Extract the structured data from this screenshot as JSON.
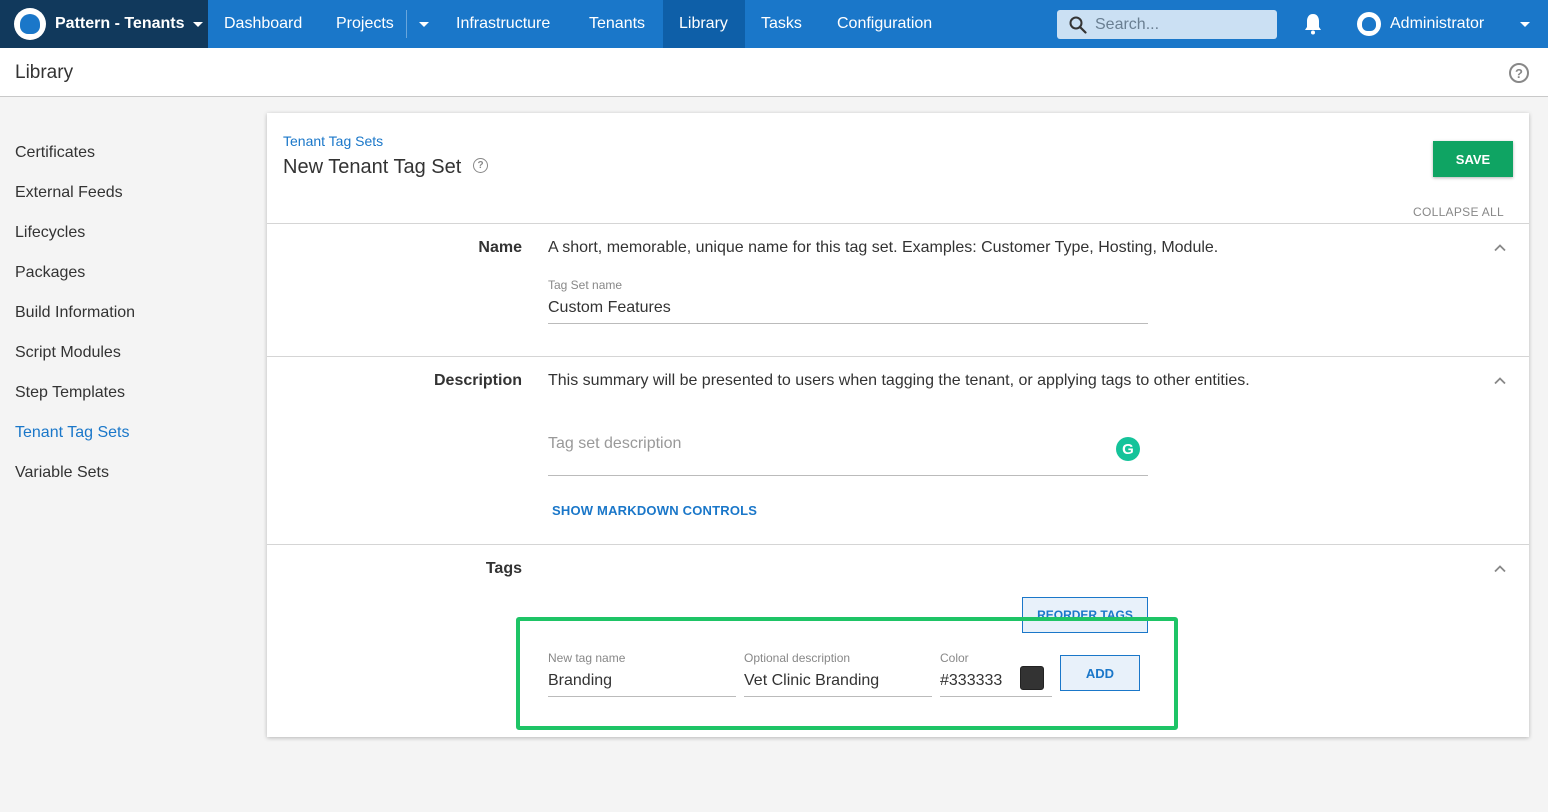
{
  "topnav": {
    "space_name": "Pattern - Tenants",
    "items": [
      {
        "label": "Dashboard"
      },
      {
        "label": "Projects"
      },
      {
        "label": "Infrastructure"
      },
      {
        "label": "Tenants"
      },
      {
        "label": "Library"
      },
      {
        "label": "Tasks"
      },
      {
        "label": "Configuration"
      }
    ],
    "active_item": "Library",
    "search_placeholder": "Search...",
    "user_name": "Administrator"
  },
  "subheader": {
    "title": "Library"
  },
  "sidebar": {
    "items": [
      {
        "label": "Certificates"
      },
      {
        "label": "External Feeds"
      },
      {
        "label": "Lifecycles"
      },
      {
        "label": "Packages"
      },
      {
        "label": "Build Information"
      },
      {
        "label": "Script Modules"
      },
      {
        "label": "Step Templates"
      },
      {
        "label": "Tenant Tag Sets"
      },
      {
        "label": "Variable Sets"
      }
    ],
    "active_item": "Tenant Tag Sets"
  },
  "page": {
    "breadcrumb": "Tenant Tag Sets",
    "title": "New Tenant Tag Set",
    "save_label": "SAVE",
    "collapse_all_label": "COLLAPSE ALL"
  },
  "sections": {
    "name": {
      "label": "Name",
      "description": "A short, memorable, unique name for this tag set. Examples: Customer Type, Hosting, Module.",
      "field_label": "Tag Set name",
      "field_value": "Custom Features"
    },
    "description": {
      "label": "Description",
      "description": "This summary will be presented to users when tagging the tenant, or applying tags to other entities.",
      "field_placeholder": "Tag set description",
      "markdown_link": "SHOW MARKDOWN CONTROLS"
    },
    "tags": {
      "label": "Tags",
      "reorder_label": "REORDER TAGS",
      "new_tag_label": "New tag name",
      "new_tag_value": "Branding",
      "desc_label": "Optional description",
      "desc_value": "Vet Clinic Branding",
      "color_label": "Color",
      "color_value": "#333333",
      "add_label": "ADD"
    }
  },
  "colors": {
    "nav_blue": "#1a77c9",
    "space_dark": "#11395c",
    "save_green": "#0fa463",
    "highlight_green": "#1ec466",
    "swatch": "#333333"
  }
}
